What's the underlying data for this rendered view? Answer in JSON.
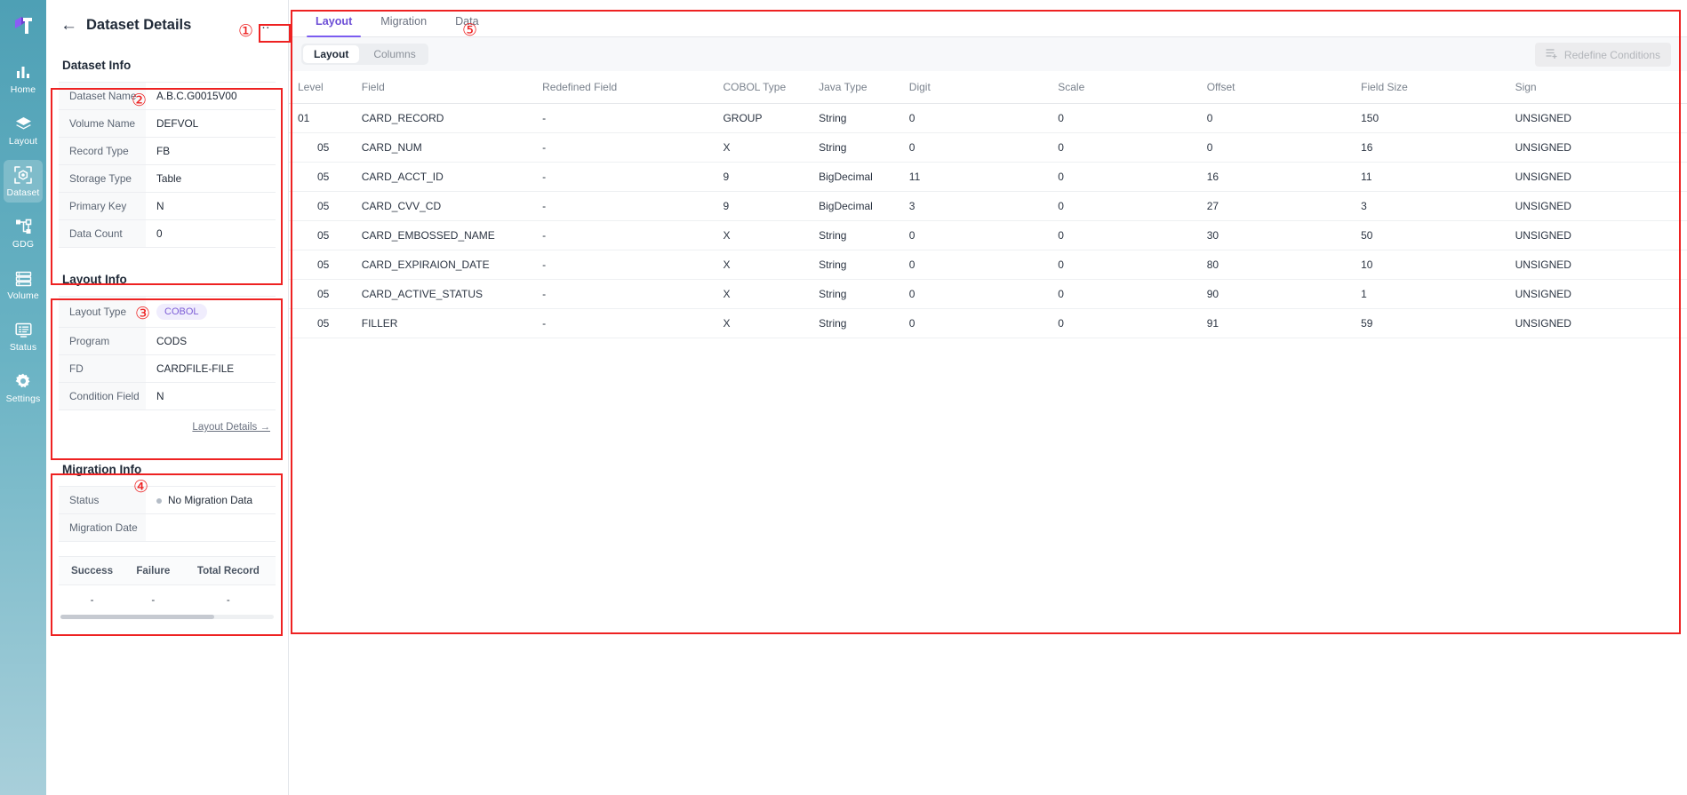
{
  "sidebar": {
    "logo_name": "app-logo",
    "items": [
      {
        "label": "Home",
        "icon": "bar-chart-icon",
        "active": false
      },
      {
        "label": "Layout",
        "icon": "layers-icon",
        "active": false
      },
      {
        "label": "Dataset",
        "icon": "dataset-cube-icon",
        "active": true
      },
      {
        "label": "GDG",
        "icon": "nodes-icon",
        "active": false
      },
      {
        "label": "Volume",
        "icon": "server-stack-icon",
        "active": false
      },
      {
        "label": "Status",
        "icon": "monitor-list-icon",
        "active": false
      },
      {
        "label": "Settings",
        "icon": "gear-icon",
        "active": false
      }
    ]
  },
  "left_panel": {
    "back_icon": "back-arrow-icon",
    "title": "Dataset Details",
    "more_menu": "…",
    "dataset_info": {
      "title": "Dataset Info",
      "rows": [
        {
          "key": "Dataset Name",
          "value": "A.B.C.G0015V00"
        },
        {
          "key": "Volume Name",
          "value": "DEFVOL"
        },
        {
          "key": "Record Type",
          "value": "FB"
        },
        {
          "key": "Storage Type",
          "value": "Table"
        },
        {
          "key": "Primary Key",
          "value": "N"
        },
        {
          "key": "Data Count",
          "value": "0"
        }
      ]
    },
    "layout_info": {
      "title": "Layout Info",
      "rows": [
        {
          "key": "Layout Type",
          "value": "COBOL",
          "badge": true
        },
        {
          "key": "Program",
          "value": "CODS",
          "badge": false
        },
        {
          "key": "FD",
          "value": "CARDFILE-FILE",
          "badge": false
        },
        {
          "key": "Condition Field",
          "value": "N",
          "badge": false
        }
      ],
      "details_link": "Layout Details →"
    },
    "migration_info": {
      "title": "Migration Info",
      "rows": [
        {
          "key": "Status",
          "value": "No Migration Data",
          "dot": true
        },
        {
          "key": "Migration Date",
          "value": "",
          "dot": false
        }
      ],
      "stats_headers": [
        "Success",
        "Failure",
        "Total Record"
      ],
      "stats_values": [
        "-",
        "-",
        "-"
      ]
    }
  },
  "main": {
    "tabs": [
      {
        "label": "Layout",
        "active": true
      },
      {
        "label": "Migration",
        "active": false
      },
      {
        "label": "Data",
        "active": false
      }
    ],
    "segments": [
      {
        "label": "Layout",
        "active": true
      },
      {
        "label": "Columns",
        "active": false
      }
    ],
    "redefine_button": {
      "label": "Redefine Conditions",
      "icon": "list-plus-icon",
      "disabled": true
    },
    "table": {
      "headers": [
        "Level",
        "Field",
        "Redefined Field",
        "COBOL Type",
        "Java Type",
        "Digit",
        "Scale",
        "Offset",
        "Field Size",
        "Sign"
      ],
      "rows": [
        {
          "level": "01",
          "field": "CARD_RECORD",
          "redefined": "-",
          "cobol_type": "GROUP",
          "java_type": "String",
          "digit": "0",
          "scale": "0",
          "offset": "0",
          "field_size": "150",
          "sign": "UNSIGNED"
        },
        {
          "level": "05",
          "field": "CARD_NUM",
          "redefined": "-",
          "cobol_type": "X",
          "java_type": "String",
          "digit": "0",
          "scale": "0",
          "offset": "0",
          "field_size": "16",
          "sign": "UNSIGNED"
        },
        {
          "level": "05",
          "field": "CARD_ACCT_ID",
          "redefined": "-",
          "cobol_type": "9",
          "java_type": "BigDecimal",
          "digit": "11",
          "scale": "0",
          "offset": "16",
          "field_size": "11",
          "sign": "UNSIGNED"
        },
        {
          "level": "05",
          "field": "CARD_CVV_CD",
          "redefined": "-",
          "cobol_type": "9",
          "java_type": "BigDecimal",
          "digit": "3",
          "scale": "0",
          "offset": "27",
          "field_size": "3",
          "sign": "UNSIGNED"
        },
        {
          "level": "05",
          "field": "CARD_EMBOSSED_NAME",
          "redefined": "-",
          "cobol_type": "X",
          "java_type": "String",
          "digit": "0",
          "scale": "0",
          "offset": "30",
          "field_size": "50",
          "sign": "UNSIGNED"
        },
        {
          "level": "05",
          "field": "CARD_EXPIRAION_DATE",
          "redefined": "-",
          "cobol_type": "X",
          "java_type": "String",
          "digit": "0",
          "scale": "0",
          "offset": "80",
          "field_size": "10",
          "sign": "UNSIGNED"
        },
        {
          "level": "05",
          "field": "CARD_ACTIVE_STATUS",
          "redefined": "-",
          "cobol_type": "X",
          "java_type": "String",
          "digit": "0",
          "scale": "0",
          "offset": "90",
          "field_size": "1",
          "sign": "UNSIGNED"
        },
        {
          "level": "05",
          "field": "FILLER",
          "redefined": "-",
          "cobol_type": "X",
          "java_type": "String",
          "digit": "0",
          "scale": "0",
          "offset": "91",
          "field_size": "59",
          "sign": "UNSIGNED"
        }
      ]
    }
  },
  "annotations": [
    {
      "num": "①"
    },
    {
      "num": "②"
    },
    {
      "num": "③"
    },
    {
      "num": "④"
    },
    {
      "num": "⑤"
    }
  ],
  "colors": {
    "accent_purple": "#7b5cf0",
    "sidebar_teal": "#4ea0b5",
    "annotation_red": "#ee2222",
    "level_blue": "#6fb3d6"
  }
}
